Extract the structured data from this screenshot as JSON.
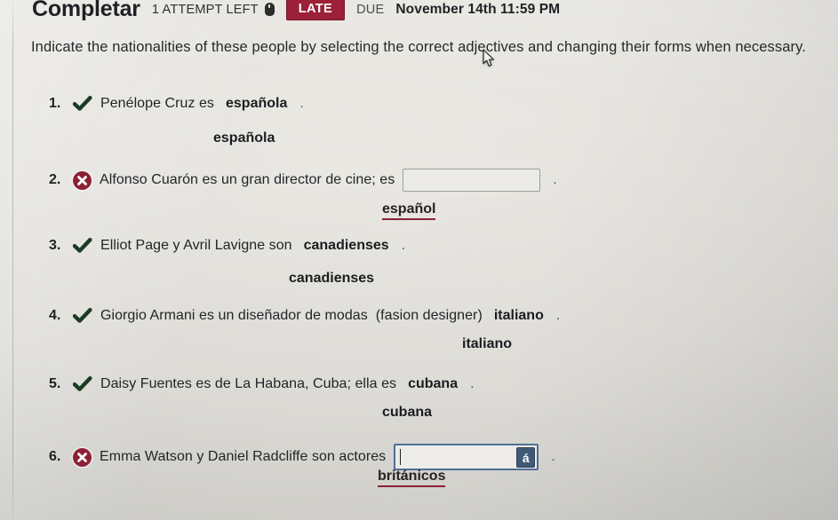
{
  "header": {
    "title": "Completar",
    "attempts": "1 ATTEMPT LEFT",
    "mouse_icon": "mouse-icon",
    "late_badge": "LATE",
    "due_label": "DUE",
    "due_date": "November 14th 11:59 PM",
    "late_badge_color": "#9c2038"
  },
  "instructions": "Indicate the nationalities of these people by selecting the correct adjectives and changing their forms when necessary.",
  "colors": {
    "correct": "#1d3b24",
    "incorrect": "#8d2036",
    "underline": "#8d2036",
    "input_border": "#9aa0a0",
    "input_focus_border": "#4e6f96",
    "accent_key_bg": "#3f5a76"
  },
  "questions": [
    {
      "number": "1.",
      "status": "correct",
      "status_icon": "check-icon",
      "prompt": "Penélope Cruz es",
      "hint": "",
      "prompt_tail": "",
      "answer": "española",
      "punctuation": ".",
      "sub_answer": "española",
      "sub_underlined": false,
      "has_input": false
    },
    {
      "number": "2.",
      "status": "incorrect",
      "status_icon": "x-circle-icon",
      "prompt": "Alfonso Cuarón es un gran director de cine; es",
      "hint": "",
      "prompt_tail": "",
      "answer": "",
      "punctuation": ".",
      "sub_answer": "español",
      "sub_underlined": true,
      "has_input": true,
      "input_value": "",
      "input_focused": false
    },
    {
      "number": "3.",
      "status": "correct",
      "status_icon": "check-icon",
      "prompt": "Elliot Page y Avril Lavigne son",
      "hint": "",
      "prompt_tail": "",
      "answer": "canadienses",
      "punctuation": ".",
      "sub_answer": "canadienses",
      "sub_underlined": false,
      "has_input": false
    },
    {
      "number": "4.",
      "status": "correct",
      "status_icon": "check-icon",
      "prompt": "Giorgio Armani es un diseñador de modas",
      "hint": "(fasion designer)",
      "prompt_tail": "",
      "answer": "italiano",
      "punctuation": ".",
      "sub_answer": "italiano",
      "sub_underlined": false,
      "has_input": false
    },
    {
      "number": "5.",
      "status": "correct",
      "status_icon": "check-icon",
      "prompt": "Daisy Fuentes es de La Habana, Cuba; ella es",
      "hint": "",
      "prompt_tail": "",
      "answer": "cubana",
      "punctuation": ".",
      "sub_answer": "cubana",
      "sub_underlined": false,
      "has_input": false
    },
    {
      "number": "6.",
      "status": "incorrect",
      "status_icon": "x-circle-icon",
      "prompt": "Emma Watson y Daniel Radcliffe son actores",
      "hint": "",
      "prompt_tail": "",
      "answer": "",
      "punctuation": ".",
      "sub_answer": "británicos",
      "sub_underlined": true,
      "has_input": true,
      "input_value": "",
      "input_focused": true,
      "accent_key_label": "á"
    }
  ]
}
